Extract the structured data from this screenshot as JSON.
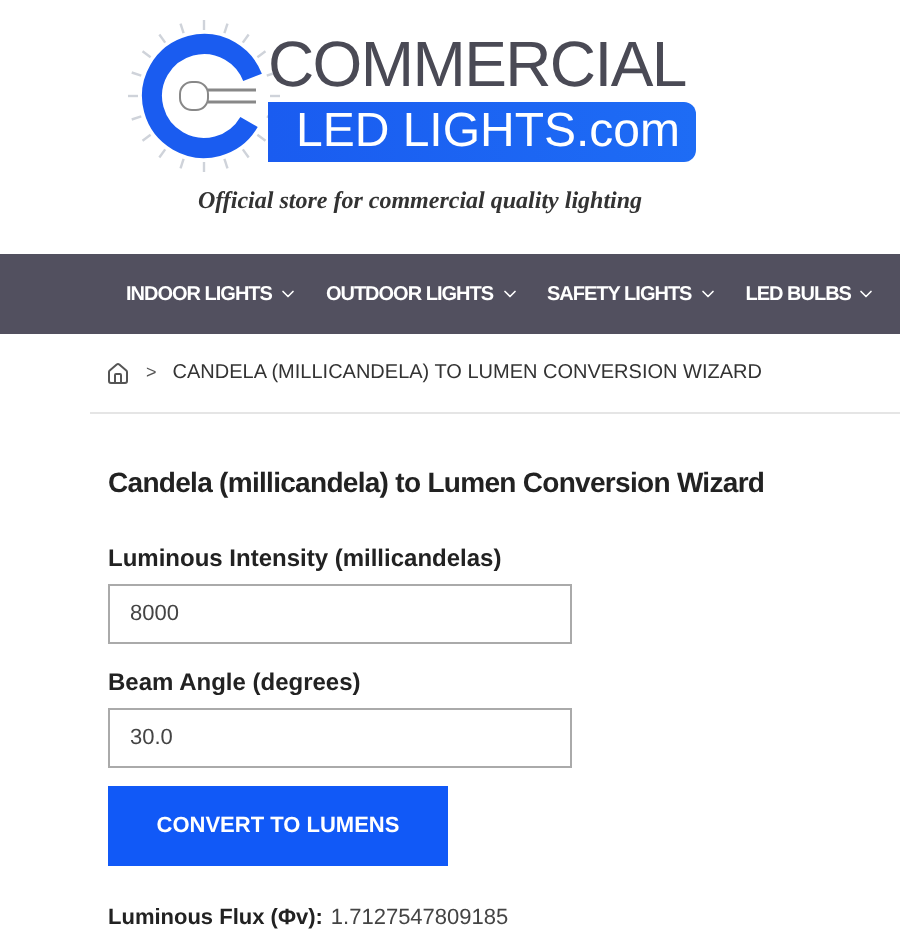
{
  "logo": {
    "top": "COMMERCIAL",
    "bottom": "LED LIGHTS.com",
    "tagline": "Official store for commercial quality lighting"
  },
  "nav": [
    {
      "label": "INDOOR LIGHTS"
    },
    {
      "label": "OUTDOOR LIGHTS"
    },
    {
      "label": "SAFETY LIGHTS"
    },
    {
      "label": "LED BULBS"
    }
  ],
  "breadcrumb": {
    "separator": ">",
    "current": "CANDELA (MILLICANDELA) TO LUMEN CONVERSION WIZARD"
  },
  "title": "Candela (millicandela) to Lumen Conversion Wizard",
  "fields": [
    {
      "label": "Luminous Intensity (millicandelas)",
      "value": "8000"
    },
    {
      "label": "Beam Angle (degrees)",
      "value": "30.0"
    }
  ],
  "button": "CONVERT TO LUMENS",
  "result": {
    "label": "Luminous Flux (Φv):",
    "value": "1.7127547809185"
  }
}
